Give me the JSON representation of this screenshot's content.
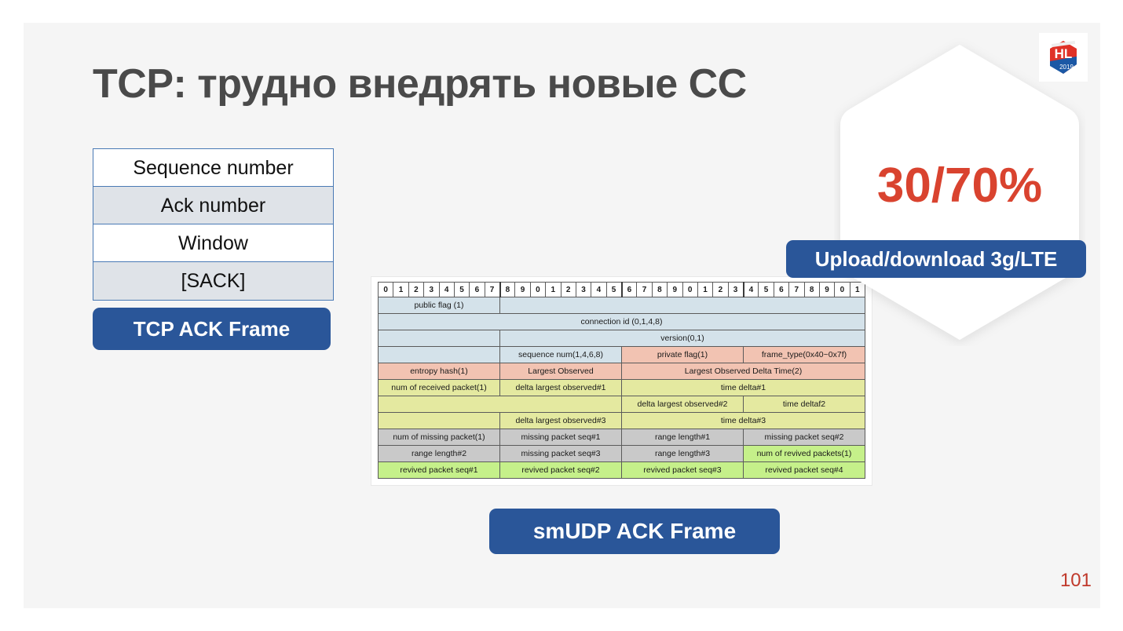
{
  "slide": {
    "title": "TCP: трудно внедрять новые CC",
    "page_number": "101",
    "accent_blue": "#2a5699",
    "accent_red": "#d9432f"
  },
  "logo": {
    "name": "highload-2019-logo",
    "initials": "HL",
    "year": "2019",
    "plus": "++",
    "red": "#e03127",
    "blue": "#1b58a5"
  },
  "tcp_frame": {
    "label": "TCP ACK Frame",
    "rows": [
      "Sequence number",
      "Ack number",
      "Window",
      "[SACK]"
    ]
  },
  "smudp_frame": {
    "label": "smUDP ACK Frame"
  },
  "badge": {
    "value": "30/70%",
    "caption": "Upload/download 3g/LTE"
  },
  "packet_diagram": {
    "bit_ruler": [
      "0",
      "1",
      "2",
      "3",
      "4",
      "5",
      "6",
      "7",
      "8",
      "9",
      "0",
      "1",
      "2",
      "3",
      "4",
      "5",
      "6",
      "7",
      "8",
      "9",
      "0",
      "1",
      "2",
      "3",
      "4",
      "5",
      "6",
      "7",
      "8",
      "9",
      "0",
      "1"
    ],
    "rows": [
      [
        {
          "text": "public flag (1)",
          "span": 8,
          "color": "blue"
        },
        {
          "text": "",
          "span": 24,
          "color": "blue"
        }
      ],
      [
        {
          "text": "connection id (0,1,4,8)",
          "span": 32,
          "color": "blue"
        }
      ],
      [
        {
          "text": "",
          "span": 8,
          "color": "blue"
        },
        {
          "text": "version(0,1)",
          "span": 24,
          "color": "blue"
        }
      ],
      [
        {
          "text": "",
          "span": 8,
          "color": "blue"
        },
        {
          "text": "sequence num(1,4,6,8)",
          "span": 8,
          "color": "blue"
        },
        {
          "text": "private flag(1)",
          "span": 8,
          "color": "pink"
        },
        {
          "text": "frame_type(0x40~0x7f)",
          "span": 8,
          "color": "pink"
        }
      ],
      [
        {
          "text": "entropy hash(1)",
          "span": 8,
          "color": "pink"
        },
        {
          "text": "Largest Observed",
          "span": 8,
          "color": "pink"
        },
        {
          "text": "Largest Observed Delta Time(2)",
          "span": 16,
          "color": "pink"
        }
      ],
      [
        {
          "text": "num of received packet(1)",
          "span": 8,
          "color": "khaki"
        },
        {
          "text": "delta largest observed#1",
          "span": 8,
          "color": "khaki"
        },
        {
          "text": "time delta#1",
          "span": 16,
          "color": "khaki"
        }
      ],
      [
        {
          "text": "",
          "span": 16,
          "color": "khaki"
        },
        {
          "text": "delta largest observed#2",
          "span": 8,
          "color": "khaki"
        },
        {
          "text": "time deltaf2",
          "span": 8,
          "color": "khaki"
        }
      ],
      [
        {
          "text": "",
          "span": 8,
          "color": "khaki"
        },
        {
          "text": "delta largest observed#3",
          "span": 8,
          "color": "khaki"
        },
        {
          "text": "time delta#3",
          "span": 16,
          "color": "khaki"
        }
      ],
      [
        {
          "text": "num of missing packet(1)",
          "span": 8,
          "color": "gray"
        },
        {
          "text": "missing packet  seq#1",
          "span": 8,
          "color": "gray"
        },
        {
          "text": "range length#1",
          "span": 8,
          "color": "gray"
        },
        {
          "text": "missing packet seq#2",
          "span": 8,
          "color": "gray"
        }
      ],
      [
        {
          "text": "range length#2",
          "span": 8,
          "color": "gray"
        },
        {
          "text": "missing packet seq#3",
          "span": 8,
          "color": "gray"
        },
        {
          "text": "range length#3",
          "span": 8,
          "color": "gray"
        },
        {
          "text": "num of revived packets(1)",
          "span": 8,
          "color": "green"
        }
      ],
      [
        {
          "text": "revived packet seq#1",
          "span": 8,
          "color": "green"
        },
        {
          "text": "revived packet seq#2",
          "span": 8,
          "color": "green"
        },
        {
          "text": "revived packet seq#3",
          "span": 8,
          "color": "green"
        },
        {
          "text": "revived packet seq#4",
          "span": 8,
          "color": "green"
        }
      ]
    ]
  }
}
